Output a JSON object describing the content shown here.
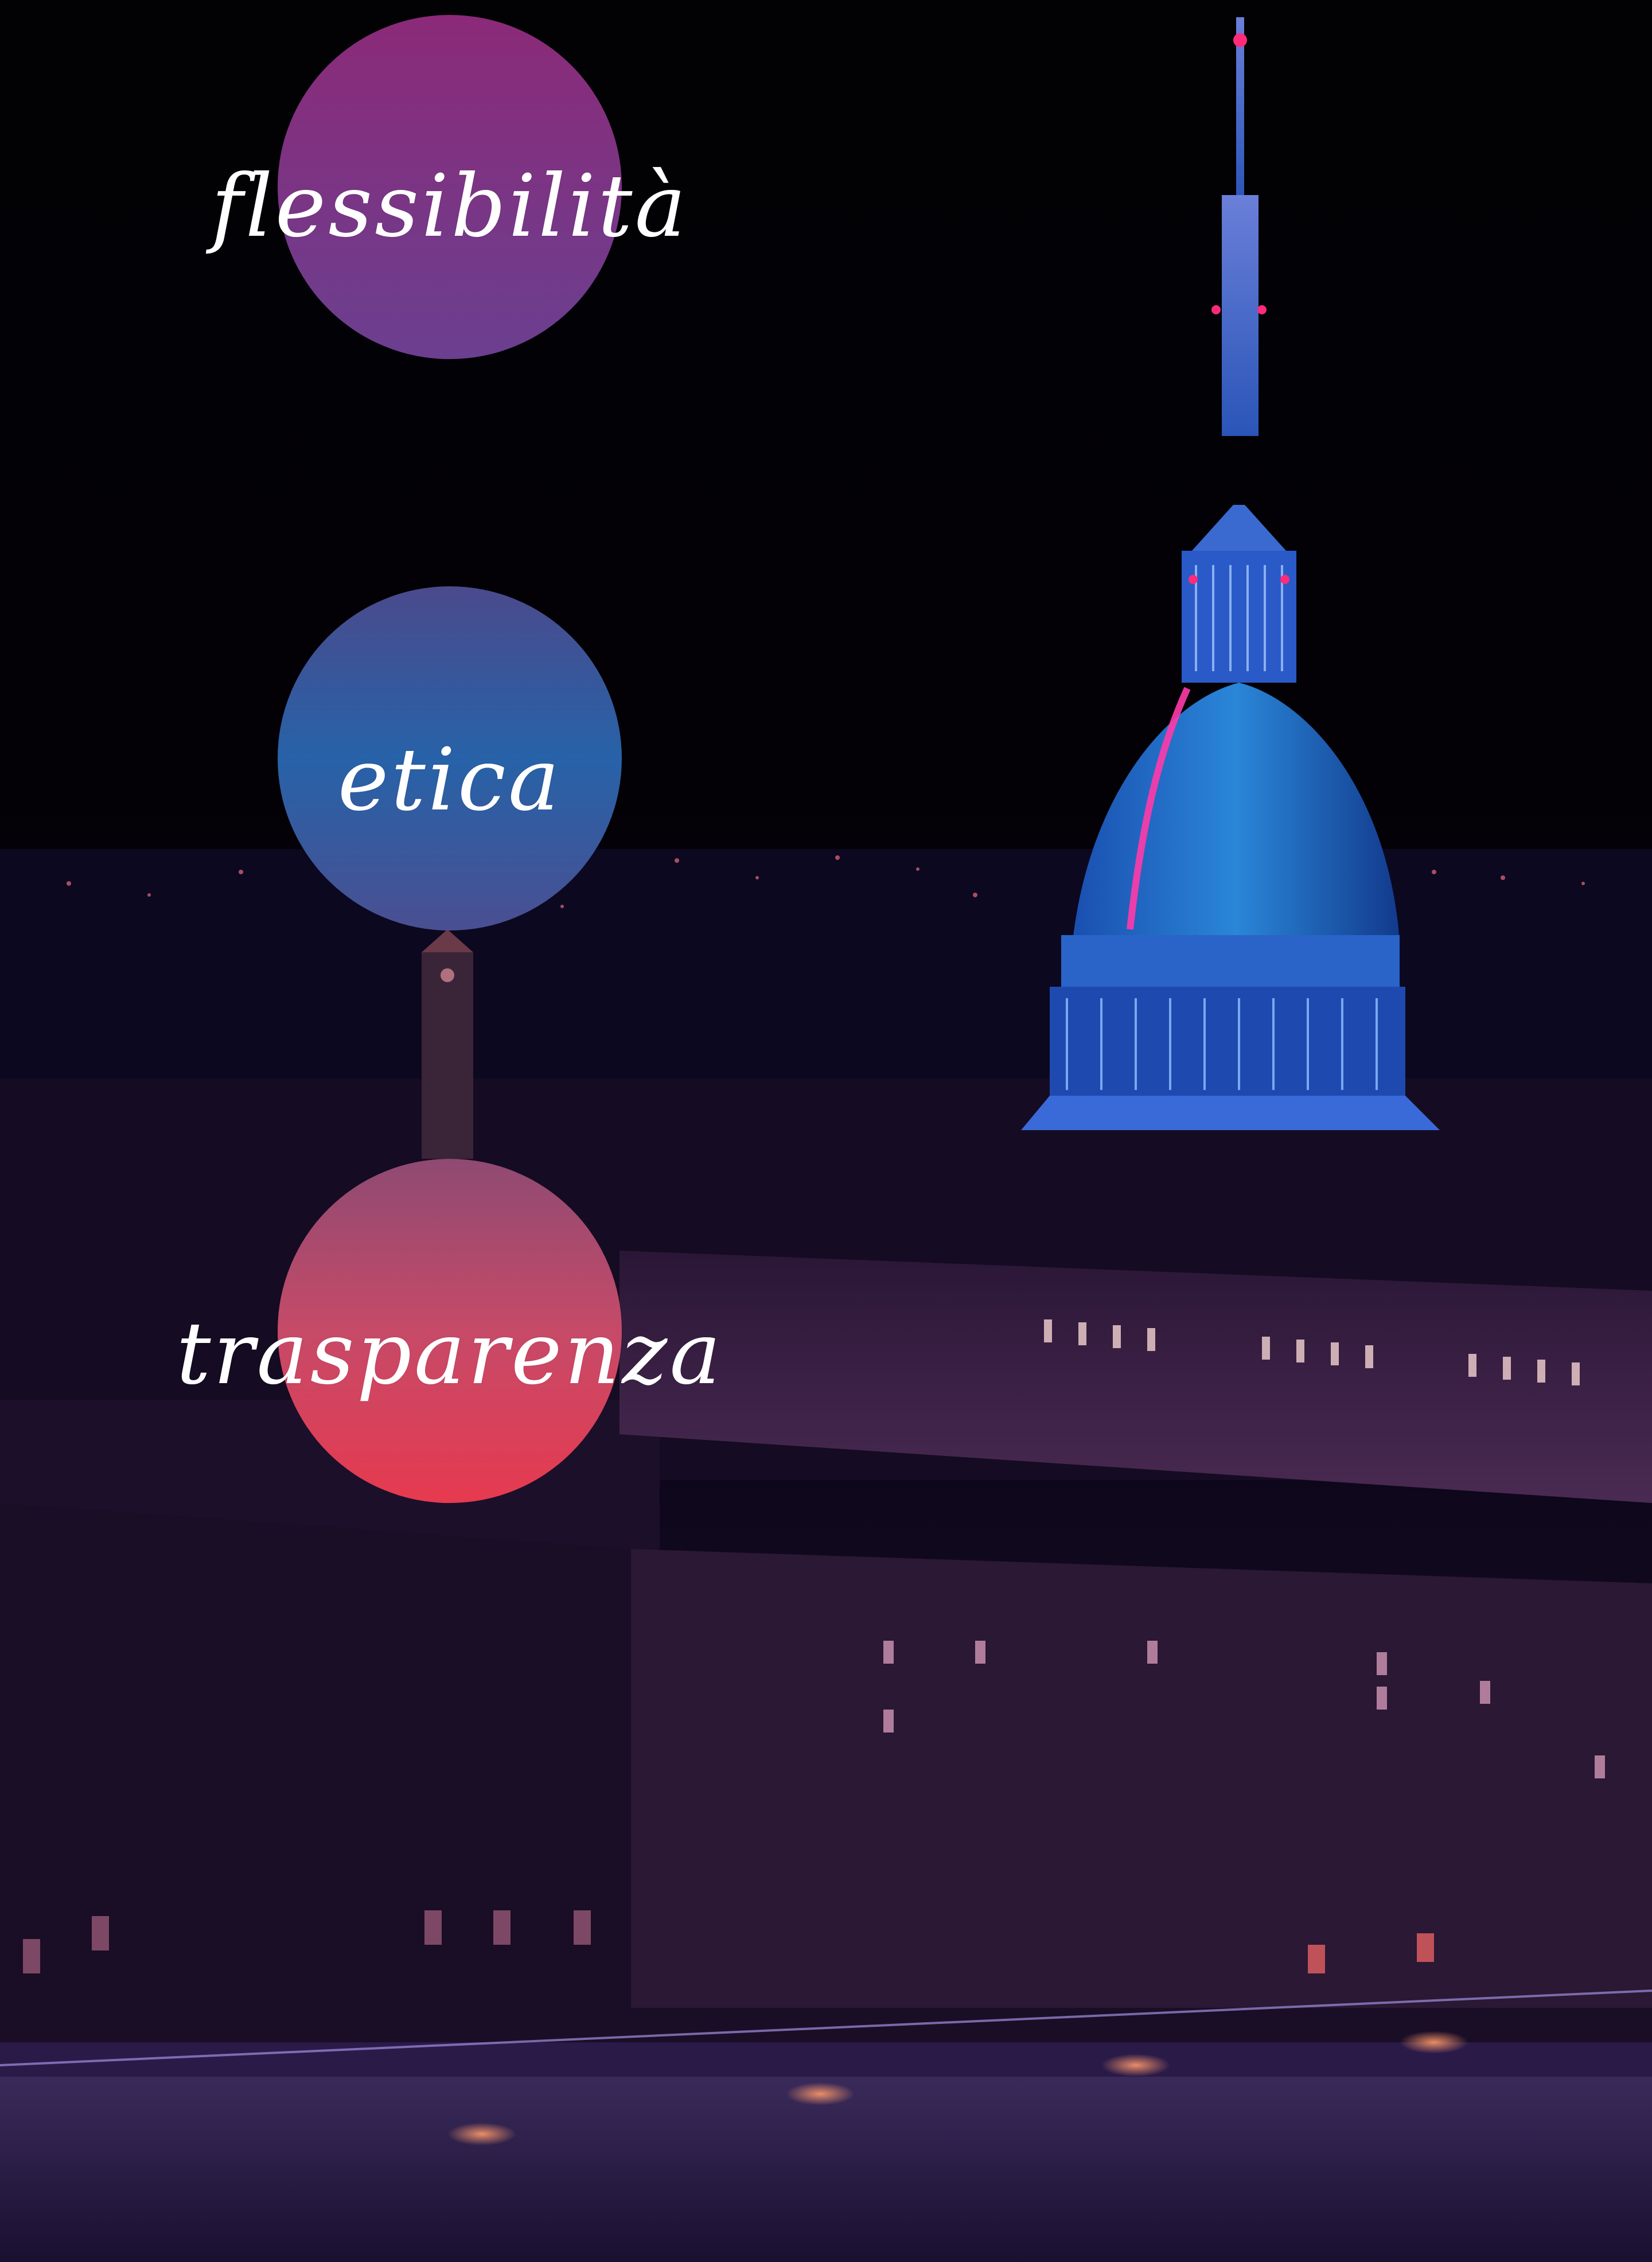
{
  "values": {
    "flessibilita": "flessibilità",
    "etica": "etica",
    "trasparenza": "trasparenza"
  },
  "colors": {
    "circle_flessibilita": [
      "#8b2a78",
      "#6b3f90"
    ],
    "circle_etica": [
      "#4a4a8c",
      "#2762a8",
      "#4a4f92"
    ],
    "circle_trasparenza": [
      "#8f4a72",
      "#c64a68",
      "#e63a4f"
    ],
    "label_text": "#ffffff"
  }
}
